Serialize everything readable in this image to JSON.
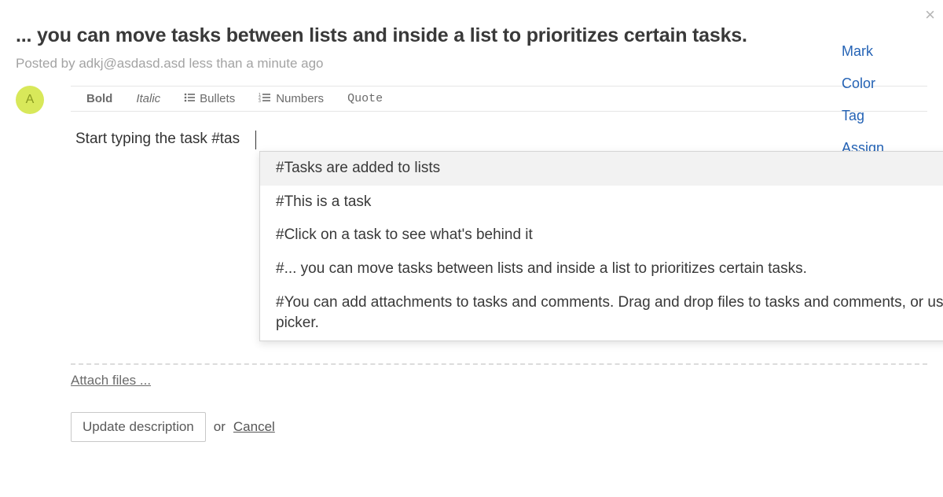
{
  "close_glyph": "×",
  "header": {
    "title": "... you can move tasks between lists and inside a list to prioritizes certain tasks.",
    "posted_by": "Posted by adkj@asdasd.asd less than a minute ago"
  },
  "side_actions": {
    "mark": "Mark",
    "color": "Color",
    "tag": "Tag",
    "assign": "Assign"
  },
  "avatar_initial": "A",
  "toolbar": {
    "bold": "Bold",
    "italic": "Italic",
    "bullets": "Bullets",
    "numbers": "Numbers",
    "quote": "Quote"
  },
  "editor": {
    "value": "Start typing the task #tas"
  },
  "suggestions": [
    "#Tasks are added to lists",
    "#This is a task",
    "#Click on a task to see what's behind it",
    "#... you can move tasks between lists and inside a list to prioritizes certain tasks.",
    "#You can add attachments to tasks and comments. Drag and drop files to tasks and comments, or use the picker."
  ],
  "attach_label": "Attach files ...",
  "actions": {
    "update": "Update description",
    "or": "or",
    "cancel": "Cancel"
  }
}
